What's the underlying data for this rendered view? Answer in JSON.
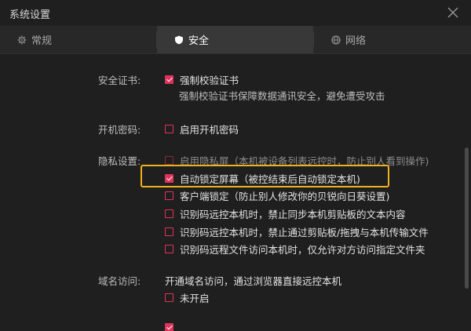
{
  "window": {
    "title": "系统设置"
  },
  "tabs": [
    {
      "label": "常规",
      "icon": "gear-icon"
    },
    {
      "label": "安全",
      "icon": "shield-icon",
      "active": true
    },
    {
      "label": "网络",
      "icon": "globe-icon"
    }
  ],
  "security": {
    "certificate": {
      "label": "安全证书:",
      "option": "强制校验证书",
      "checked": true,
      "description": "强制校验证书保障数据通讯安全，避免遭受攻击"
    },
    "boot_password": {
      "label": "开机密码:",
      "option": "启用开机密码",
      "checked": false
    },
    "privacy": {
      "label": "隐私设置:",
      "options": [
        {
          "text": "启用隐私屏（本机被设备列表远控时，防止别人看到操作)",
          "checked": false
        },
        {
          "text": "自动锁定屏幕（被控结束后自动锁定本机)",
          "checked": true
        },
        {
          "text": "客户端锁定（防止别人修改你的贝锐向日葵设置)",
          "checked": false
        },
        {
          "text": "识别码远控本机时，禁止同步本机剪贴板的文本内容",
          "checked": false
        },
        {
          "text": "识别码远控本机时，禁止通过剪贴板/拖拽与本机传输文件",
          "checked": false
        },
        {
          "text": "识别码远程文件访问本机时，仅允许对方访问指定文件夹",
          "checked": false
        }
      ]
    },
    "domain_access": {
      "label": "域名访问:",
      "description": "开通域名访问，通过浏览器直接远控本机",
      "option": "未开启",
      "checked": false
    }
  },
  "colors": {
    "accent": "#e0325a",
    "highlight": "#f2b01e",
    "active_tab": "#383838"
  }
}
